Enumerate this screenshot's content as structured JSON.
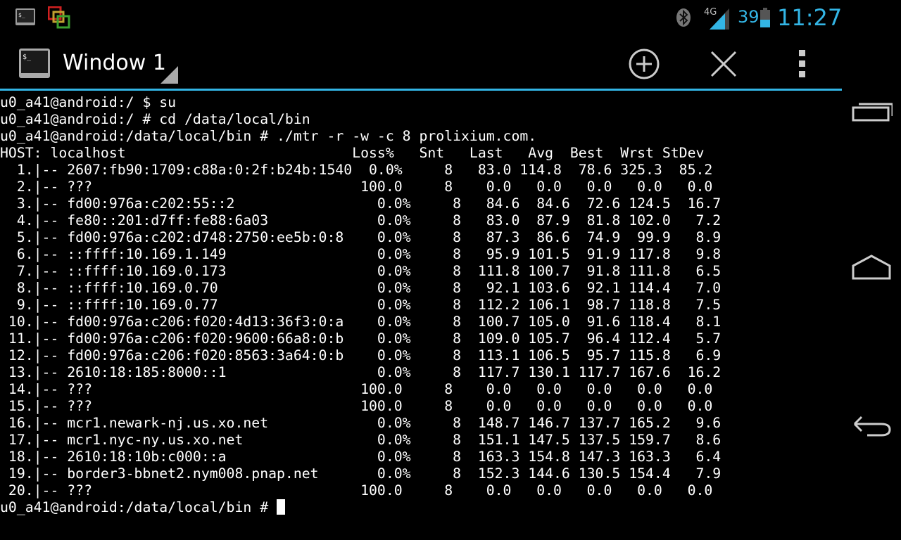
{
  "status_bar": {
    "icons": [
      "terminal-notification-icon",
      "multiwindow-icon",
      "bluetooth-icon",
      "signal-4g-icon",
      "battery-icon"
    ],
    "network_label": "4G",
    "battery_level": "39",
    "clock": "11:27",
    "accent_color": "#33b5e5"
  },
  "action_bar": {
    "title": "Window 1",
    "icons": [
      "terminal-app-icon",
      "spinner-triangle-icon",
      "add-circle-icon",
      "close-x-icon",
      "overflow-dots-icon"
    ]
  },
  "terminal": {
    "lines": [
      "u0_a41@android:/ $ su",
      "u0_a41@android:/ # cd /data/local/bin",
      "u0_a41@android:/data/local/bin # ./mtr -r -w -c 8 prolixium.com.",
      "HOST: localhost                           Loss%   Snt   Last   Avg  Best  Wrst StDev",
      "  1.|-- 2607:fb90:1709:c88a:0:2f:b24b:1540  0.0%     8   83.0 114.8  78.6 325.3  85.2",
      "  2.|-- ???                                100.0     8    0.0   0.0   0.0   0.0   0.0",
      "  3.|-- fd00:976a:c202:55::2                 0.0%     8   84.6  84.6  72.6 124.5  16.7",
      "  4.|-- fe80::201:d7ff:fe88:6a03             0.0%     8   83.0  87.9  81.8 102.0   7.2",
      "  5.|-- fd00:976a:c202:d748:2750:ee5b:0:8    0.0%     8   87.3  86.6  74.9  99.9   8.9",
      "  6.|-- ::ffff:10.169.1.149                  0.0%     8   95.9 101.5  91.9 117.8   9.8",
      "  7.|-- ::ffff:10.169.0.173                  0.0%     8  111.8 100.7  91.8 111.8   6.5",
      "  8.|-- ::ffff:10.169.0.70                   0.0%     8   92.1 103.6  92.1 114.4   7.0",
      "  9.|-- ::ffff:10.169.0.77                   0.0%     8  112.2 106.1  98.7 118.8   7.5",
      " 10.|-- fd00:976a:c206:f020:4d13:36f3:0:a    0.0%     8  100.7 105.0  91.6 118.4   8.1",
      " 11.|-- fd00:976a:c206:f020:9600:66a8:0:b    0.0%     8  109.0 105.7  96.4 112.4   5.7",
      " 12.|-- fd00:976a:c206:f020:8563:3a64:0:b    0.0%     8  113.1 106.5  95.7 115.8   6.9",
      " 13.|-- 2610:18:185:8000::1                  0.0%     8  117.7 130.1 117.7 167.6  16.2",
      " 14.|-- ???                                100.0     8    0.0   0.0   0.0   0.0   0.0",
      " 15.|-- ???                                100.0     8    0.0   0.0   0.0   0.0   0.0",
      " 16.|-- mcr1.newark-nj.us.xo.net             0.0%     8  148.7 146.7 137.7 165.2   9.6",
      " 17.|-- mcr1.nyc-ny.us.xo.net                0.0%     8  151.1 147.5 137.5 159.7   8.6",
      " 18.|-- 2610:18:10b:c000::a                  0.0%     8  163.3 154.8 147.3 163.3   6.4",
      " 19.|-- border3-bbnet2.nym008.pnap.net       0.0%     8  152.3 144.6 130.5 154.4   7.9",
      " 20.|-- ???                                100.0     8    0.0   0.0   0.0   0.0   0.0"
    ],
    "prompt": "u0_a41@android:/data/local/bin # "
  },
  "nav_bar": {
    "icons": [
      "recent-apps-icon",
      "home-icon",
      "back-icon"
    ]
  }
}
